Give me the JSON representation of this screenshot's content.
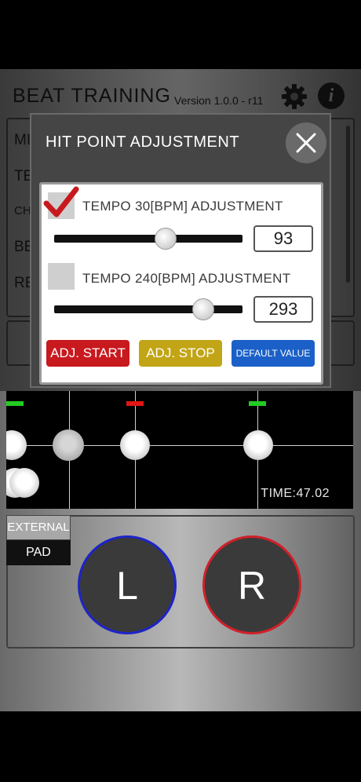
{
  "app": {
    "title": "BEAT TRAINING",
    "version": "Version 1.0.0 - r11"
  },
  "menu": {
    "items": [
      "MI",
      "TE",
      "CH",
      "BE",
      "RE"
    ]
  },
  "dialog": {
    "title": "HIT POINT ADJUSTMENT",
    "close_icon": "close-icon",
    "tempo30": {
      "label": "TEMPO 30[BPM] ADJUSTMENT",
      "checked": true,
      "value": "93",
      "slider_fraction": 0.59
    },
    "tempo240": {
      "label": "TEMPO 240[BPM] ADJUSTMENT",
      "checked": false,
      "value": "293",
      "slider_fraction": 0.79
    },
    "buttons": {
      "start": "ADJ. START",
      "stop": "ADJ. STOP",
      "default": "DEFAULT VALUE"
    }
  },
  "timeline": {
    "time": "TIME:47.02",
    "markers": [
      {
        "color": "#22cc22"
      },
      {
        "color": "#e01515"
      },
      {
        "color": "#22cc22"
      }
    ]
  },
  "pads": {
    "external_top": "EXTERNAL",
    "external_bottom": "PAD",
    "left": "L",
    "right": "R"
  },
  "colors": {
    "start": "#c8191e",
    "stop": "#c2a516",
    "default": "#1b60c8",
    "left_pad_ring": "#1d24c8",
    "right_pad_ring": "#d0202a"
  }
}
